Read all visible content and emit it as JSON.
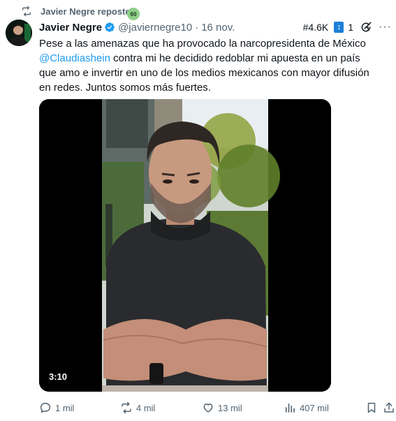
{
  "repost": {
    "text": "Javier Negre reposteó",
    "badge": "60"
  },
  "author": {
    "name": "Javier Negre",
    "handle": "@javiernegre10",
    "separator": "·",
    "date": "16 nov."
  },
  "header_right": {
    "rank": "#4.6K",
    "sort_glyph": "↕",
    "count": "1",
    "more": "···"
  },
  "tweet": {
    "part1": "Pese a las amenazas que ha provocado la narcopresidenta de México",
    "mention": "@Claudiashein",
    "part2": " contra mi he decidido redoblar mi apuesta en un país que amo e invertir en uno de los medios mexicanos con mayor difusión en redes. Juntos somos más fuertes."
  },
  "video": {
    "duration": "3:10"
  },
  "actions": {
    "replies": "1 mil",
    "reposts": "4 mil",
    "likes": "13 mil",
    "views": "407 mil"
  },
  "colors": {
    "accent": "#1d9bf0",
    "muted": "#536471",
    "text": "#0f1419",
    "repost_green": "#00ba7c"
  },
  "icons": [
    "repost-icon",
    "verified-icon",
    "grok-icon",
    "reply-icon",
    "retweet-icon",
    "like-icon",
    "views-icon",
    "bookmark-icon",
    "share-icon"
  ]
}
